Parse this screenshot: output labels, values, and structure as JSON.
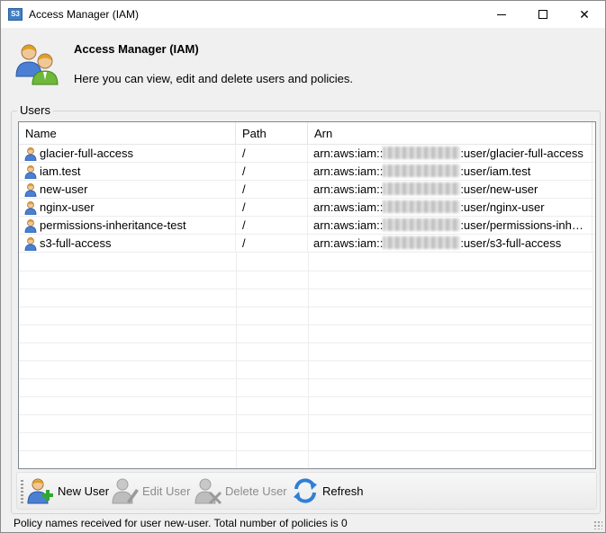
{
  "window": {
    "title": "Access Manager (IAM)",
    "app_icon_text": "S3",
    "controls": {
      "minimize": "minimize",
      "maximize": "maximize",
      "close": "✕"
    }
  },
  "header": {
    "title": "Access Manager (IAM)",
    "description": "Here you can view, edit and delete users and policies."
  },
  "users_group": {
    "label": "Users",
    "columns": {
      "name": "Name",
      "path": "Path",
      "arn": "Arn"
    },
    "rows": [
      {
        "name": "glacier-full-access",
        "path": "/",
        "arn_prefix": "arn:aws:iam::",
        "arn_suffix": ":user/glacier-full-access"
      },
      {
        "name": "iam.test",
        "path": "/",
        "arn_prefix": "arn:aws:iam::",
        "arn_suffix": ":user/iam.test"
      },
      {
        "name": "new-user",
        "path": "/",
        "arn_prefix": "arn:aws:iam::",
        "arn_suffix": ":user/new-user"
      },
      {
        "name": "nginx-user",
        "path": "/",
        "arn_prefix": "arn:aws:iam::",
        "arn_suffix": ":user/nginx-user"
      },
      {
        "name": "permissions-inheritance-test",
        "path": "/",
        "arn_prefix": "arn:aws:iam::",
        "arn_suffix": ":user/permissions-inh…"
      },
      {
        "name": "s3-full-access",
        "path": "/",
        "arn_prefix": "arn:aws:iam::",
        "arn_suffix": ":user/s3-full-access"
      }
    ]
  },
  "toolbar": {
    "new_user": "New User",
    "edit_user": "Edit User",
    "delete_user": "Delete User",
    "refresh": "Refresh"
  },
  "status": {
    "text": "Policy names received for user new-user. Total number of policies is 0"
  },
  "colors": {
    "accent_blue": "#3f7fc7",
    "user_icon_blue": "#4a7fd4",
    "user_icon_gold": "#f0c030",
    "add_green": "#2fa82f",
    "disabled_gray": "#8c8c8c"
  },
  "icons": {
    "header": "users-group-icon",
    "row": "user-icon",
    "new_user": "add-user-icon",
    "edit_user": "edit-user-icon",
    "delete_user": "delete-user-icon",
    "refresh": "refresh-icon"
  }
}
